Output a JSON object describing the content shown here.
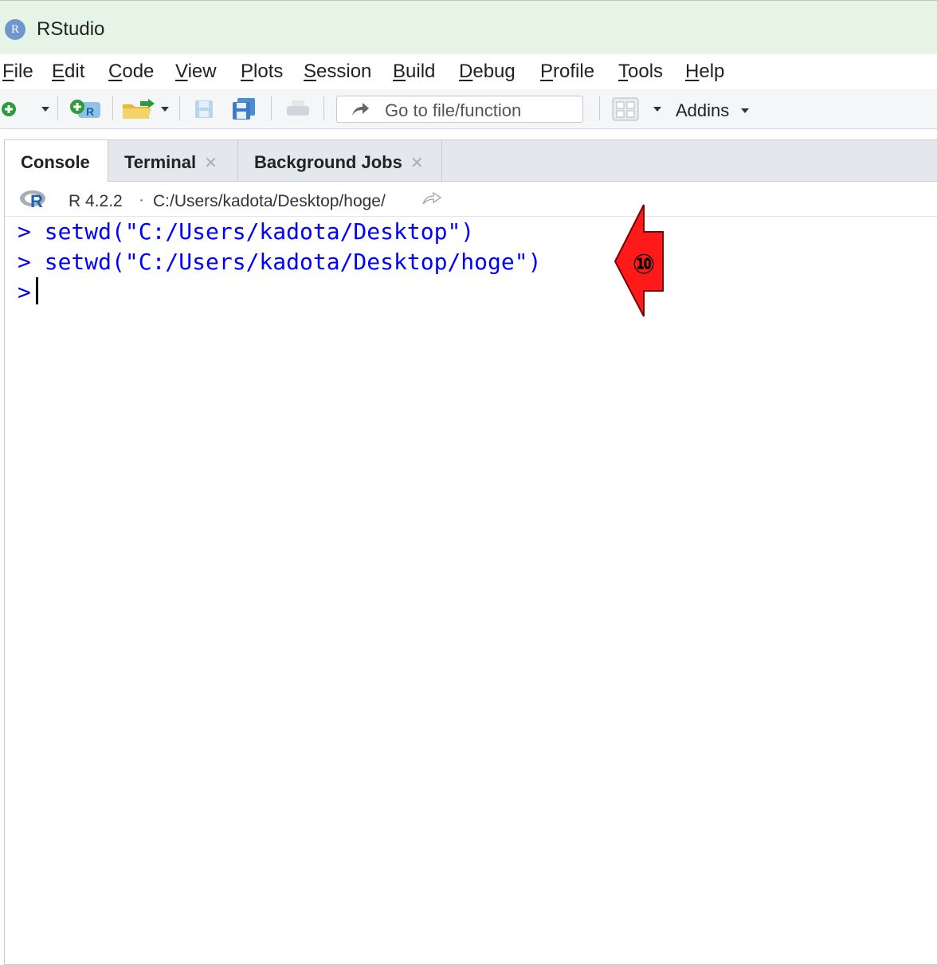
{
  "window": {
    "title": "RStudio",
    "logo_letter": "R"
  },
  "menu": [
    {
      "key": "F",
      "rest": "ile"
    },
    {
      "key": "E",
      "rest": "dit"
    },
    {
      "key": "C",
      "rest": "ode"
    },
    {
      "key": "V",
      "rest": "iew"
    },
    {
      "key": "P",
      "rest": "lots"
    },
    {
      "key": "S",
      "rest": "ession"
    },
    {
      "key": "B",
      "rest": "uild"
    },
    {
      "key": "D",
      "rest": "ebug"
    },
    {
      "key": "P",
      "rest": "rofile"
    },
    {
      "key": "T",
      "rest": "ools"
    },
    {
      "key": "H",
      "rest": "elp"
    }
  ],
  "toolbar": {
    "goto_placeholder": "Go to file/function",
    "addins_label": "Addins",
    "icons": [
      "new-file-icon",
      "new-project-icon",
      "open-file-icon",
      "save-icon",
      "save-all-icon",
      "print-icon",
      "goto-arrow-icon",
      "grid-layout-icon"
    ]
  },
  "tabs": [
    {
      "label": "Console",
      "closable": false,
      "active": true
    },
    {
      "label": "Terminal",
      "closable": true,
      "active": false
    },
    {
      "label": "Background Jobs",
      "closable": true,
      "active": false
    }
  ],
  "console_header": {
    "version": "R 4.2.2",
    "separator": "·",
    "path": "C:/Users/kadota/Desktop/hoge/"
  },
  "console_lines": [
    "> setwd(\"C:/Users/kadota/Desktop\")",
    "> setwd(\"C:/Users/kadota/Desktop/hoge\")"
  ],
  "prompt": ">",
  "annotation": {
    "label": "⑩",
    "color": "#ff0000"
  },
  "colors": {
    "titlebar": "#e5f4e5",
    "console_text": "#0000ff",
    "tabbar": "#e4e7ec"
  }
}
